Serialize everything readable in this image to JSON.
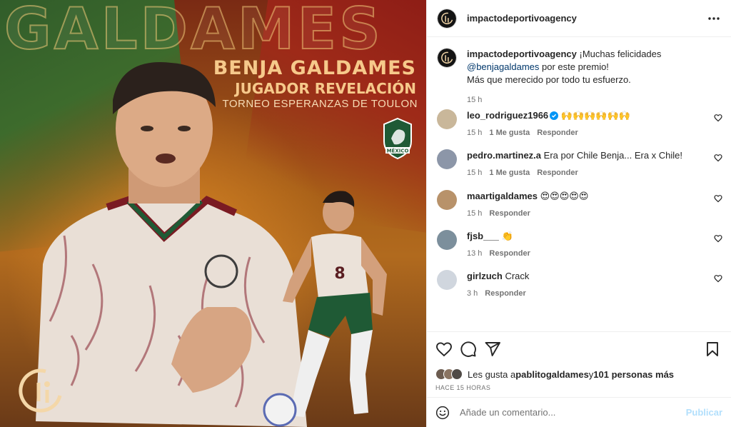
{
  "post": {
    "overlay": {
      "bg_title": "GALDAMES",
      "player_name": "BENJA GALDAMES",
      "award": "JUGADOR REVELACIÓN",
      "tournament": "TORNEO ESPERANZAS DE TOULON",
      "crest_text": "MÉXICO",
      "jersey_number": "8"
    }
  },
  "header": {
    "username": "impactodeportivoagency",
    "more_icon": "more-horizontal-icon"
  },
  "caption": {
    "username": "impactodeportivoagency",
    "text_before": "¡Muchas felicidades ",
    "mention": "@benjagaldames",
    "text_after": " por este premio!",
    "line2": "Más que merecido por todo tu esfuerzo.",
    "time": "15 h"
  },
  "comments": [
    {
      "username": "leo_rodriguez1966",
      "verified": true,
      "text": "🙌🙌🙌🙌🙌🙌",
      "time": "15 h",
      "likes": "1 Me gusta",
      "reply": "Responder",
      "avatar_color": "#c9b79a"
    },
    {
      "username": "pedro.martinez.a",
      "verified": false,
      "text": "Era por Chile Benja... Era x Chile!",
      "time": "15 h",
      "likes": "1 Me gusta",
      "reply": "Responder",
      "avatar_color": "#8c96a8"
    },
    {
      "username": "maartigaldames",
      "verified": false,
      "text": "😍😍😍😍😍",
      "time": "15 h",
      "likes": "",
      "reply": "Responder",
      "avatar_color": "#b8926a"
    },
    {
      "username": "fjsb___",
      "verified": false,
      "text": "👏",
      "time": "13 h",
      "likes": "",
      "reply": "Responder",
      "avatar_color": "#7c8f9c"
    },
    {
      "username": "girlzuch",
      "verified": false,
      "text": "Crack",
      "time": "3 h",
      "likes": "",
      "reply": "Responder",
      "avatar_color": "#d0d6de"
    }
  ],
  "actions": {
    "like_icon": "heart-icon",
    "comment_icon": "comment-icon",
    "share_icon": "send-icon",
    "save_icon": "bookmark-icon"
  },
  "likes": {
    "prefix": "Les gusta a ",
    "user": "pablitogaldames",
    "middle": " y ",
    "others": "101 personas más"
  },
  "timestamp": "HACE 15 HORAS",
  "add_comment": {
    "placeholder": "Añade un comentario...",
    "publish": "Publicar",
    "emoji_icon": "emoji-icon"
  },
  "colors": {
    "accent": "#0095f6",
    "publish_disabled": "#b2dffc",
    "mention": "#00376b",
    "verified": "#0095f6"
  }
}
